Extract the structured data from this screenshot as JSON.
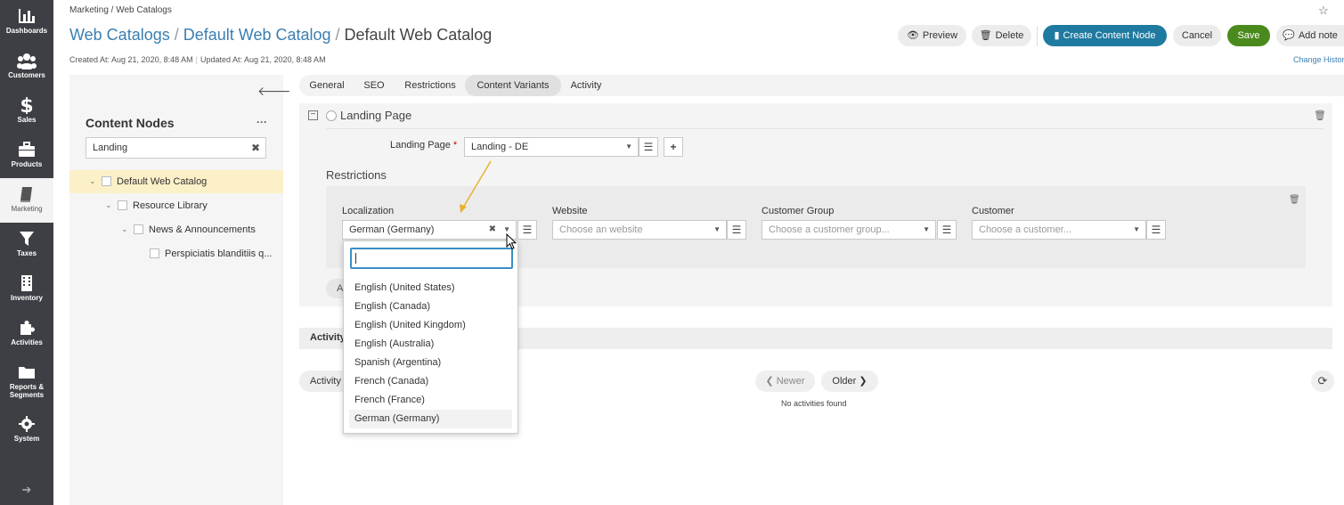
{
  "main_menu": {
    "items": [
      {
        "label": "Dashboards",
        "icon": "bar-chart-icon"
      },
      {
        "label": "Customers",
        "icon": "users-icon"
      },
      {
        "label": "Sales",
        "icon": "dollar-icon"
      },
      {
        "label": "Products",
        "icon": "briefcase-icon"
      },
      {
        "label": "Marketing",
        "icon": "book-icon",
        "active": true
      },
      {
        "label": "Taxes",
        "icon": "filter-icon"
      },
      {
        "label": "Inventory",
        "icon": "building-icon"
      },
      {
        "label": "Activities",
        "icon": "puzzle-icon"
      },
      {
        "label": "Reports & Segments",
        "icon": "folder-icon"
      },
      {
        "label": "System",
        "icon": "gear-icon"
      }
    ]
  },
  "header": {
    "breadcrumb": "Marketing / Web Catalogs",
    "title_link_1": "Web Catalogs",
    "title_link_2": "Default Web Catalog",
    "title_current": "Default Web Catalog",
    "separator": "/",
    "created_at": "Created At: Aug 21, 2020, 8:48 AM",
    "updated_at": "Updated At: Aug 21, 2020, 8:48 AM",
    "buttons": {
      "preview": "Preview",
      "delete": "Delete",
      "create_content_node": "Create Content Node",
      "cancel": "Cancel",
      "save": "Save",
      "add_note": "Add note"
    },
    "change_history": "Change Histor"
  },
  "tree": {
    "title": "Content Nodes",
    "search_value": "Landing",
    "nodes": [
      {
        "label": "Default Web Catalog"
      },
      {
        "label": "Resource Library"
      },
      {
        "label": "News & Announcements"
      },
      {
        "label": "Perspiciatis blanditiis q..."
      }
    ]
  },
  "tabs": [
    "General",
    "SEO",
    "Restrictions",
    "Content Variants",
    "Activity"
  ],
  "variant": {
    "title": "Landing Page",
    "landing_page_label": "Landing Page",
    "landing_page_value": "Landing - DE",
    "restrictions_title": "Restrictions",
    "localization_label": "Localization",
    "localization_value": "German (Germany)",
    "website_label": "Website",
    "website_placeholder": "Choose an website",
    "customer_group_label": "Customer Group",
    "customer_group_placeholder": "Choose a customer group...",
    "customer_label": "Customer",
    "customer_placeholder": "Choose a customer...",
    "add_button_partial": "A"
  },
  "activity": {
    "title": "Activity",
    "activity_type_partial": "Activity T",
    "newer": "Newer",
    "older": "Older",
    "no_activities": "No activities found"
  },
  "localization_dropdown": {
    "search_value": "",
    "options": [
      "English (United States)",
      "English (Canada)",
      "English (United Kingdom)",
      "English (Australia)",
      "Spanish (Argentina)",
      "French (Canada)",
      "French (France)",
      "German (Germany)"
    ],
    "selected": "German (Germany)"
  },
  "colors": {
    "sidebar": "#3d3f44",
    "link": "#3b7fb0",
    "primary": "#1f7aa0",
    "save": "#4a8a1c",
    "annotation_arrow": "#e8b22e"
  }
}
